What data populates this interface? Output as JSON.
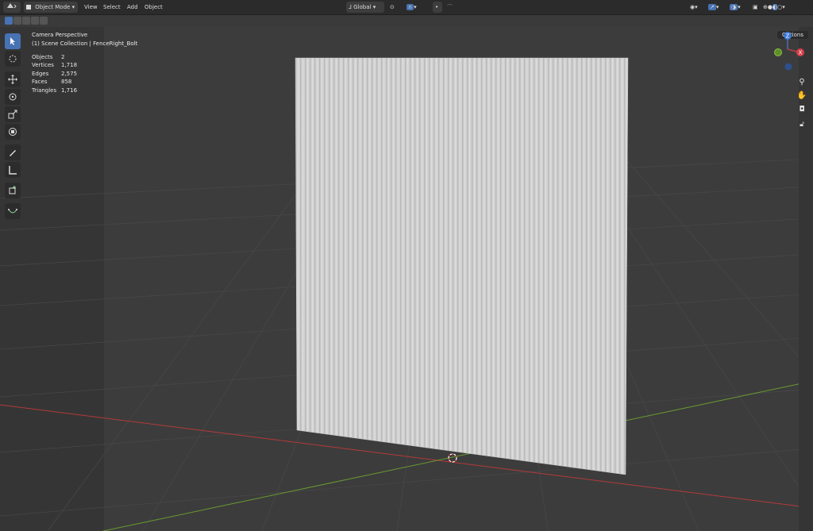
{
  "header": {
    "mode_label": "Object Mode",
    "menus": [
      "View",
      "Select",
      "Add",
      "Object"
    ],
    "transform_orientation": "Global"
  },
  "viewport": {
    "view_name": "Camera Perspective",
    "collection_line": "(1) Scene Collection | FenceRight_Bolt",
    "options_label": "Options",
    "stats": [
      {
        "label": "Objects",
        "value": "2"
      },
      {
        "label": "Vertices",
        "value": "1,718"
      },
      {
        "label": "Edges",
        "value": "2,575"
      },
      {
        "label": "Faces",
        "value": "858"
      },
      {
        "label": "Triangles",
        "value": "1,716"
      }
    ],
    "gizmo": {
      "z": "Z",
      "x": "X"
    }
  },
  "colors": {
    "accent": "#4772b3",
    "x_axis": "#b43a3a",
    "y_axis": "#6a9a30",
    "panel": "#2b2b2b"
  },
  "tools": [
    "select-box",
    "cursor",
    "move",
    "rotate",
    "scale",
    "transform",
    "annotate",
    "measure",
    "add-cube",
    "extrude-curve"
  ]
}
